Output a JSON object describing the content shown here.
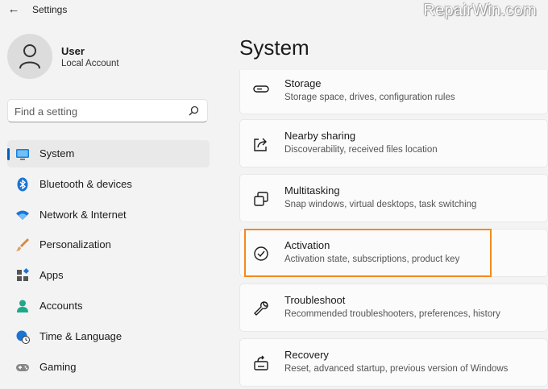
{
  "window": {
    "title": "Settings",
    "watermark": "RepairWin.com"
  },
  "account": {
    "name": "User",
    "type": "Local Account"
  },
  "search": {
    "placeholder": "Find a setting"
  },
  "nav": {
    "items": [
      {
        "label": "System",
        "icon": "monitor-icon",
        "active": true
      },
      {
        "label": "Bluetooth & devices",
        "icon": "bluetooth-icon"
      },
      {
        "label": "Network & Internet",
        "icon": "wifi-icon"
      },
      {
        "label": "Personalization",
        "icon": "brush-icon"
      },
      {
        "label": "Apps",
        "icon": "apps-icon"
      },
      {
        "label": "Accounts",
        "icon": "person-icon"
      },
      {
        "label": "Time & Language",
        "icon": "globe-clock-icon"
      },
      {
        "label": "Gaming",
        "icon": "gamepad-icon"
      }
    ]
  },
  "main": {
    "title": "System",
    "cards": [
      {
        "title": "Storage",
        "subtitle": "Storage space, drives, configuration rules",
        "icon": "storage-icon"
      },
      {
        "title": "Nearby sharing",
        "subtitle": "Discoverability, received files location",
        "icon": "share-icon"
      },
      {
        "title": "Multitasking",
        "subtitle": "Snap windows, virtual desktops, task switching",
        "icon": "multitasking-icon"
      },
      {
        "title": "Activation",
        "subtitle": "Activation state, subscriptions, product key",
        "icon": "check-circle-icon",
        "highlighted": true
      },
      {
        "title": "Troubleshoot",
        "subtitle": "Recommended troubleshooters, preferences, history",
        "icon": "wrench-icon"
      },
      {
        "title": "Recovery",
        "subtitle": "Reset, advanced startup, previous version of Windows",
        "icon": "recovery-icon"
      }
    ]
  },
  "colors": {
    "accent": "#005fb8",
    "highlight": "#f28a1e",
    "background": "#f3f3f3",
    "card": "#fbfbfb"
  }
}
